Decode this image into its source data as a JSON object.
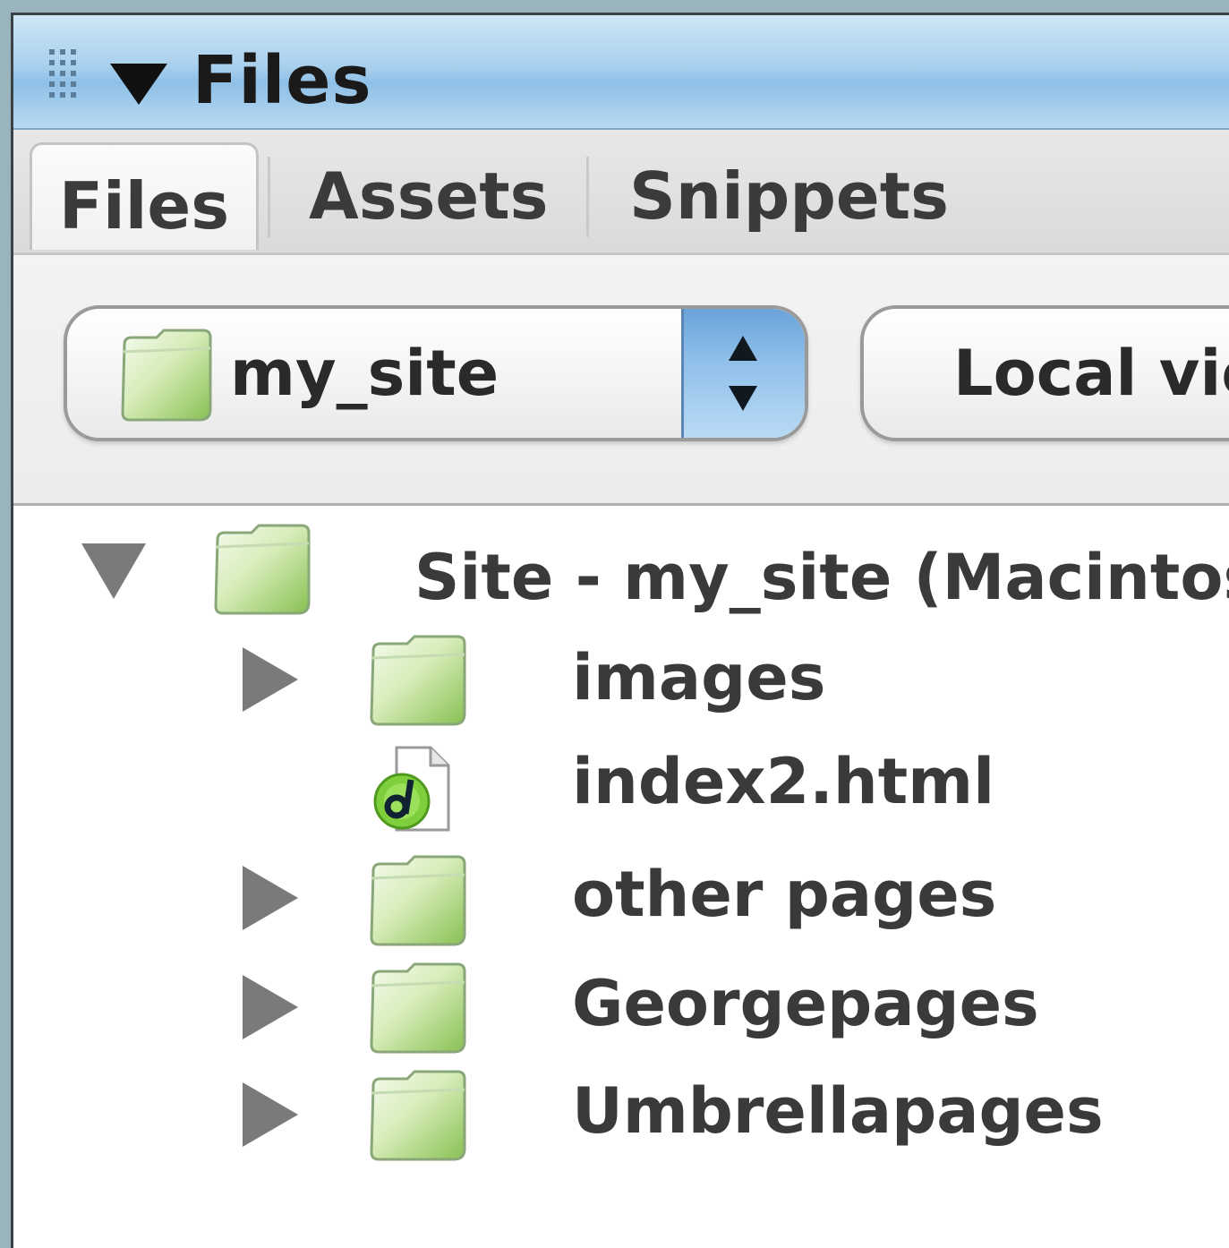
{
  "panel": {
    "title": "Files"
  },
  "tabs": [
    {
      "label": "Files",
      "active": true
    },
    {
      "label": "Assets",
      "active": false
    },
    {
      "label": "Snippets",
      "active": false
    }
  ],
  "toolbar": {
    "site_select": {
      "value": "my_site"
    },
    "view_select": {
      "value": "Local view"
    }
  },
  "tree": {
    "root": {
      "label": "Site - my_site (Macintosh HD:",
      "expanded": true,
      "icon": "folder-icon"
    },
    "items": [
      {
        "label": "images",
        "type": "folder",
        "expanded": false,
        "icon": "folder-icon"
      },
      {
        "label": "index2.html",
        "type": "file",
        "icon": "dreamweaver-file-icon"
      },
      {
        "label": "other pages",
        "type": "folder",
        "expanded": false,
        "icon": "folder-icon"
      },
      {
        "label": "Georgepages",
        "type": "folder",
        "expanded": false,
        "icon": "folder-icon"
      },
      {
        "label": "Umbrellapages",
        "type": "folder",
        "expanded": false,
        "icon": "folder-icon"
      }
    ]
  },
  "colors": {
    "titlebar_blue": "#a9d0ee",
    "folder_green": "#9fcf6a",
    "select_stepper_blue": "#8fbfe9"
  }
}
